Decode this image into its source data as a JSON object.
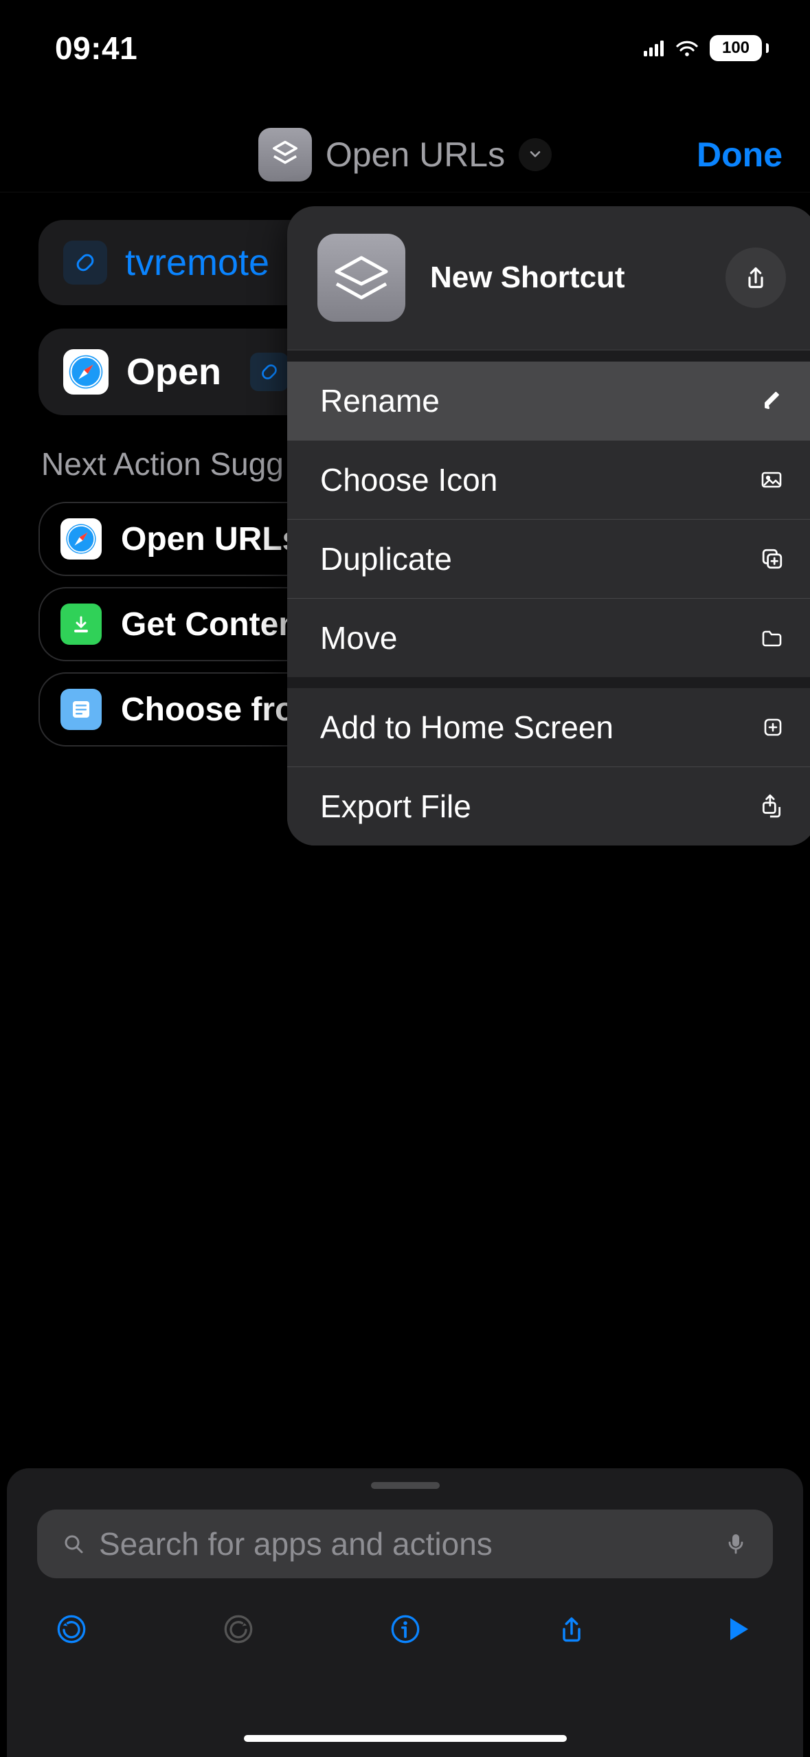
{
  "status": {
    "time": "09:41",
    "battery": "100"
  },
  "nav": {
    "title": "Open URLs",
    "done": "Done"
  },
  "actions": {
    "url_param": "tvremote",
    "open_label": "Open"
  },
  "suggestions": {
    "heading": "Next Action Sugg",
    "items": [
      {
        "label": "Open URLs"
      },
      {
        "label": "Get Content"
      },
      {
        "label": "Choose fro"
      }
    ]
  },
  "popover": {
    "title": "New Shortcut",
    "menu1": [
      {
        "label": "Rename",
        "icon": "pencil",
        "highlight": true
      },
      {
        "label": "Choose Icon",
        "icon": "photo"
      },
      {
        "label": "Duplicate",
        "icon": "plus-square-stack"
      },
      {
        "label": "Move",
        "icon": "folder"
      }
    ],
    "menu2": [
      {
        "label": "Add to Home Screen",
        "icon": "plus-square"
      },
      {
        "label": "Export File",
        "icon": "share-stack"
      }
    ]
  },
  "search": {
    "placeholder": "Search for apps and actions"
  }
}
